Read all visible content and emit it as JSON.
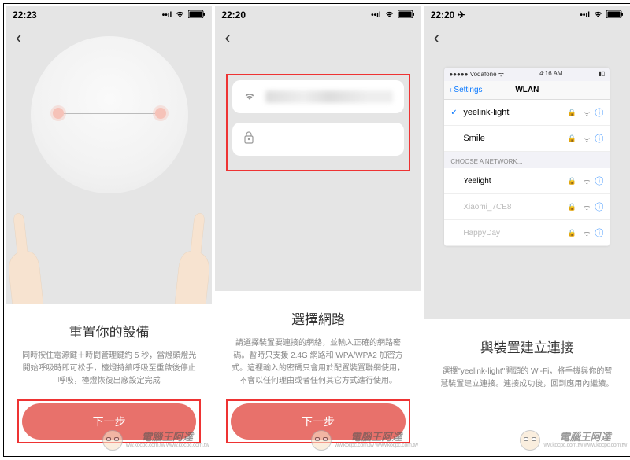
{
  "screens": {
    "reset": {
      "time": "22:23",
      "title": "重置你的設備",
      "desc": "同時按住電源鍵＋時間管理鍵約 5 秒，當燈頭燈光開始呼吸時即可松手，檯燈持續呼吸至重啟後停止呼吸，檯燈恢復出廠設定完成",
      "button": "下一步"
    },
    "network": {
      "time": "22:20",
      "title": "選擇網路",
      "desc": "請選擇裝置要連接的網絡，並輸入正確的網路密碼。暫時只支援 2.4G 網路和 WPA/WPA2 加密方式。這裡輸入的密碼只會用於配置裝置聯網使用，不會以任何理由或者任何其它方式進行使用。",
      "button": "下一步",
      "ssid_blurred": true,
      "password_placeholder": ""
    },
    "connect": {
      "time": "22:20",
      "title": "與裝置建立連接",
      "desc": "選擇\"yeelink-light\"開頭的 Wi-Fi，將手機與你的智慧裝置建立連接。連接成功後，回到應用內繼續。",
      "wlan": {
        "carrier": "Vodafone",
        "inner_time": "4:16 AM",
        "back": "Settings",
        "header": "WLAN",
        "connected": [
          {
            "name": "yeelink-light",
            "checked": true
          },
          {
            "name": "Smile",
            "checked": false
          }
        ],
        "section": "CHOOSE A NETWORK...",
        "list": [
          {
            "name": "Yeelight",
            "enabled": true
          },
          {
            "name": "Xiaomi_7CE8",
            "enabled": false
          },
          {
            "name": "HappyDay",
            "enabled": false
          }
        ]
      }
    }
  },
  "watermark": {
    "cn": "電腦王阿達",
    "url": "ww.kocpc.com.tw www.kocpc.com.tw"
  }
}
